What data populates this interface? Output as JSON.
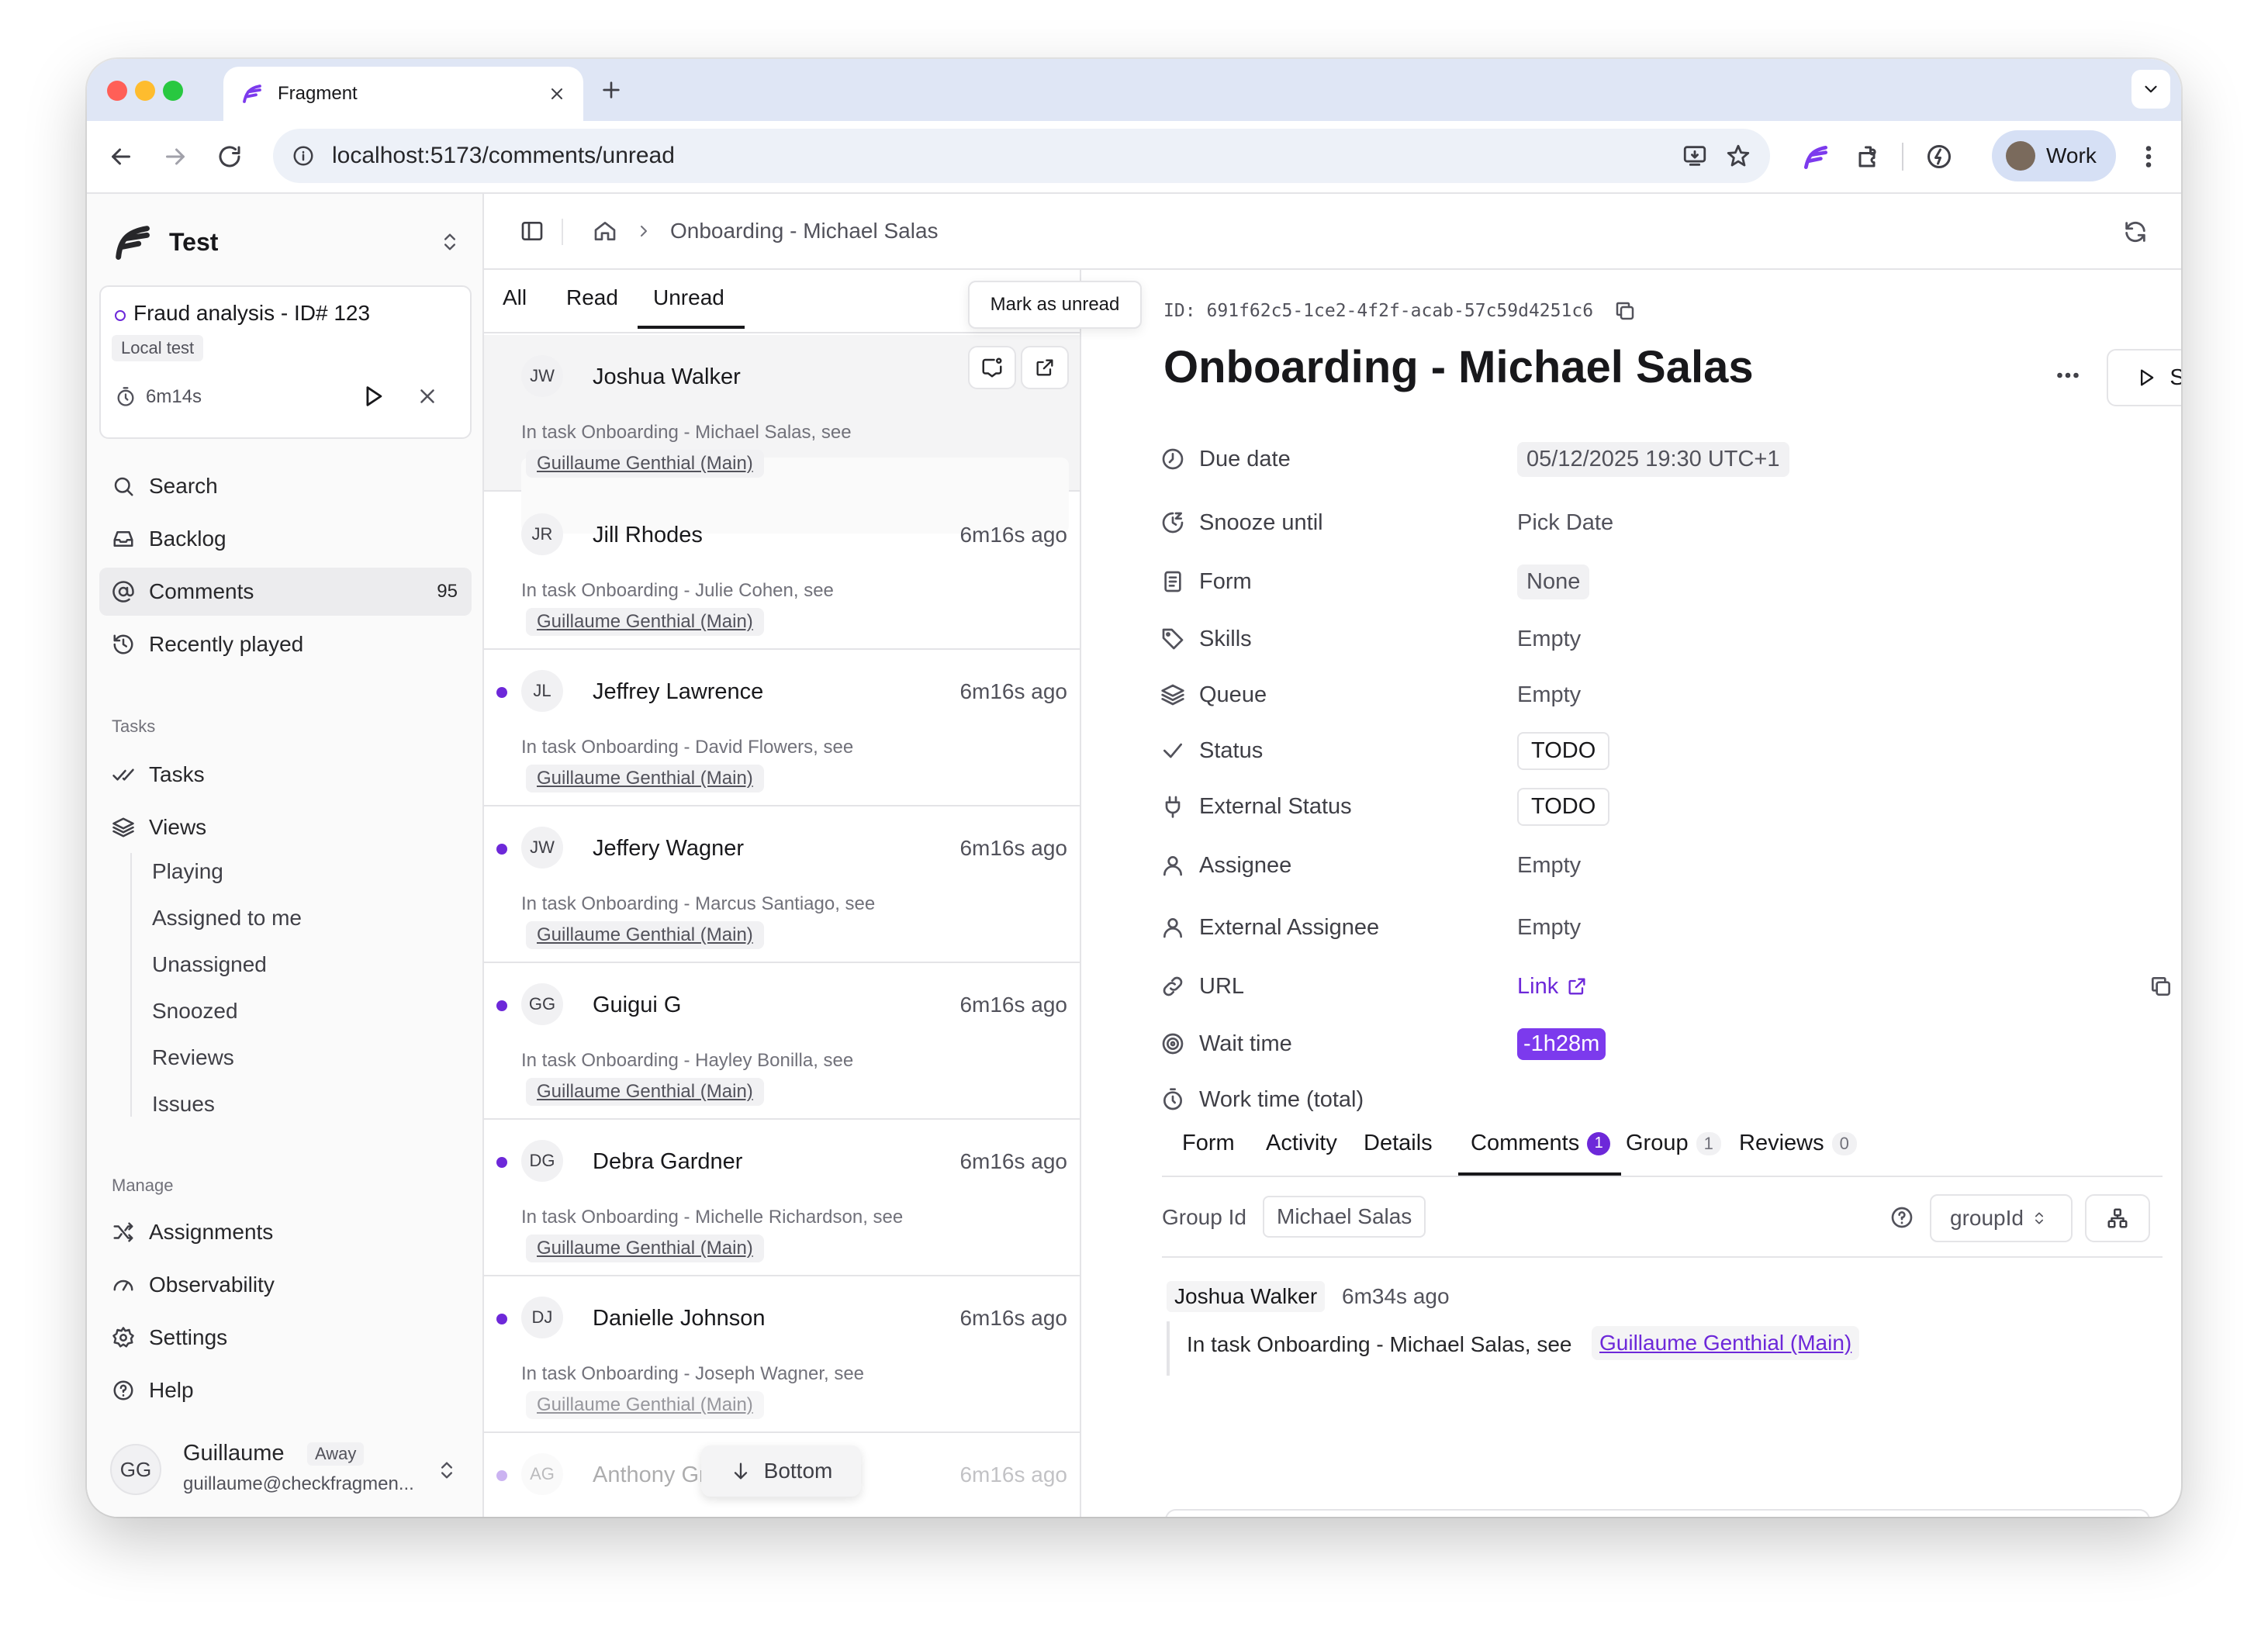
{
  "browser": {
    "tab_title": "Fragment",
    "url": "localhost:5173/comments/unread",
    "profile_label": "Work",
    "traffic_colors": [
      "#ff5f57",
      "#febc2e",
      "#28c840"
    ],
    "accent": "#6d28d9"
  },
  "sidebar": {
    "workspace": "Test",
    "active_task": {
      "title": "Fraud analysis - ID# 123",
      "tag": "Local test",
      "timer": "6m14s"
    },
    "nav": [
      {
        "label": "Search",
        "icon": "search-icon"
      },
      {
        "label": "Backlog",
        "icon": "inbox-icon"
      },
      {
        "label": "Comments",
        "icon": "at-sign-icon",
        "count": "95"
      },
      {
        "label": "Recently played",
        "icon": "history-icon"
      }
    ],
    "tasks_section": "Tasks",
    "tasks_nav": [
      {
        "label": "Tasks",
        "icon": "checks-icon"
      },
      {
        "label": "Views",
        "icon": "layers-icon"
      }
    ],
    "views": [
      "Playing",
      "Assigned to me",
      "Unassigned",
      "Snoozed",
      "Reviews",
      "Issues"
    ],
    "manage_section": "Manage",
    "manage_nav": [
      {
        "label": "Assignments",
        "icon": "shuffle-icon"
      },
      {
        "label": "Observability",
        "icon": "gauge-icon"
      },
      {
        "label": "Settings",
        "icon": "gear-icon"
      },
      {
        "label": "Help",
        "icon": "help-circle-icon"
      }
    ],
    "user": {
      "initials": "GG",
      "name": "Guillaume",
      "status": "Away",
      "email": "guillaume@checkfragmen..."
    }
  },
  "topbar": {
    "breadcrumb": "Onboarding - Michael Salas"
  },
  "list": {
    "tabs": [
      "All",
      "Read",
      "Unread"
    ],
    "active_tab": "Unread",
    "tooltip": "Mark as unread",
    "bottom_button": "Bottom",
    "items": [
      {
        "initials": "JW",
        "name": "Joshua Walker",
        "time": "",
        "snippet": "In task Onboarding - Michael Salas, see",
        "link": "Guillaume Genthial (Main)",
        "unread": false
      },
      {
        "initials": "JR",
        "name": "Jill Rhodes",
        "time": "6m16s ago",
        "snippet": "In task Onboarding - Julie Cohen, see",
        "link": "Guillaume Genthial (Main)",
        "unread": false
      },
      {
        "initials": "JL",
        "name": "Jeffrey Lawrence",
        "time": "6m16s ago",
        "snippet": "In task Onboarding - David Flowers, see",
        "link": "Guillaume Genthial (Main)",
        "unread": true
      },
      {
        "initials": "JW",
        "name": "Jeffery Wagner",
        "time": "6m16s ago",
        "snippet": "In task Onboarding - Marcus Santiago, see",
        "link": "Guillaume Genthial (Main)",
        "unread": true
      },
      {
        "initials": "GG",
        "name": "Guigui G",
        "time": "6m16s ago",
        "snippet": "In task Onboarding - Hayley Bonilla, see",
        "link": "Guillaume Genthial (Main)",
        "unread": true
      },
      {
        "initials": "DG",
        "name": "Debra Gardner",
        "time": "6m16s ago",
        "snippet": "In task Onboarding - Michelle Richardson, see",
        "link": "Guillaume Genthial (Main)",
        "unread": true
      },
      {
        "initials": "DJ",
        "name": "Danielle Johnson",
        "time": "6m16s ago",
        "snippet": "In task Onboarding - Joseph Wagner, see",
        "link": "Guillaume Genthial (Main)",
        "unread": true
      },
      {
        "initials": "AG",
        "name": "Anthony Gr",
        "time": "6m16s ago",
        "snippet": "",
        "link": "",
        "unread": true
      }
    ]
  },
  "detail": {
    "id_label": "ID:",
    "id_value": "691f62c5-1ce2-4f2f-acab-57c59d4251c6",
    "title": "Onboarding - Michael Salas",
    "start_label": "Start",
    "properties": [
      {
        "label": "Due date",
        "icon": "clock-icon",
        "value": "05/12/2025 19:30 UTC+1",
        "style": "gray"
      },
      {
        "label": "Snooze until",
        "icon": "snooze-icon",
        "value": "Pick Date",
        "style": "plain"
      },
      {
        "label": "Form",
        "icon": "form-icon",
        "value": "None",
        "style": "gray"
      },
      {
        "label": "Skills",
        "icon": "tag-icon",
        "value": "Empty",
        "style": "plain"
      },
      {
        "label": "Queue",
        "icon": "layers-icon",
        "value": "Empty",
        "style": "plain"
      },
      {
        "label": "Status",
        "icon": "check-icon",
        "value": "TODO",
        "style": "outline"
      },
      {
        "label": "External Status",
        "icon": "plug-icon",
        "value": "TODO",
        "style": "outline"
      },
      {
        "label": "Assignee",
        "icon": "user-icon",
        "value": "Empty",
        "style": "plain"
      },
      {
        "label": "External Assignee",
        "icon": "user-icon",
        "value": "Empty",
        "style": "plain"
      },
      {
        "label": "URL",
        "icon": "link-icon",
        "value": "Link",
        "style": "link"
      },
      {
        "label": "Wait time",
        "icon": "target-icon",
        "value": "-1h28m",
        "style": "purple"
      },
      {
        "label": "Work time (total)",
        "icon": "timer-icon",
        "value": "",
        "style": "plain"
      }
    ],
    "tabs": [
      {
        "label": "Form",
        "count": ""
      },
      {
        "label": "Activity",
        "count": ""
      },
      {
        "label": "Details",
        "count": ""
      },
      {
        "label": "Comments",
        "count": "1"
      },
      {
        "label": "Group",
        "count": "1"
      },
      {
        "label": "Reviews",
        "count": "0"
      }
    ],
    "active_tab": "Comments",
    "group_label": "Group Id",
    "group_value": "Michael Salas",
    "group_select": "groupId",
    "comment": {
      "author": "Joshua Walker",
      "time": "6m34s ago",
      "text": "In task Onboarding - Michael Salas, see",
      "link": "Guillaume Genthial (Main)"
    }
  }
}
